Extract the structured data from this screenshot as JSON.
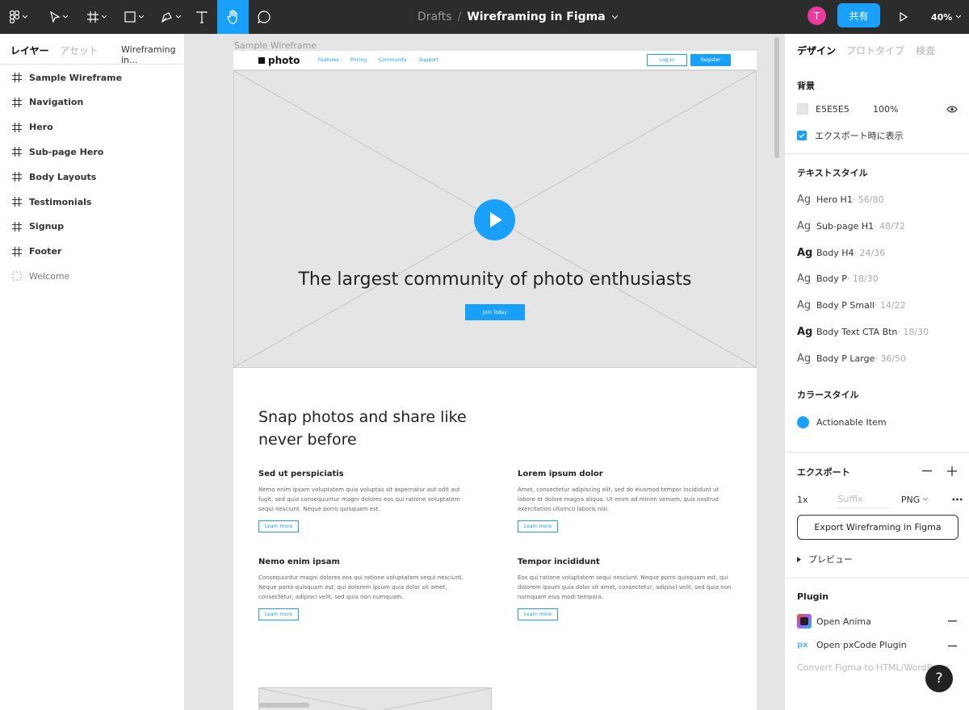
{
  "toolbar": {
    "breadcrumb_drafts": "Drafts",
    "breadcrumb_separator": "/",
    "file_name": "Wireframing in Figma",
    "avatar_initial": "T",
    "share_label": "共有",
    "zoom_label": "40%"
  },
  "layers_panel": {
    "tab_layers": "レイヤー",
    "tab_assets": "アセット",
    "tab_page": "Wireframing in...",
    "items": [
      {
        "label": "Sample Wireframe"
      },
      {
        "label": "Navigation"
      },
      {
        "label": "Hero"
      },
      {
        "label": "Sub-page Hero"
      },
      {
        "label": "Body Layouts"
      },
      {
        "label": "Testimonials"
      },
      {
        "label": "Signup"
      },
      {
        "label": "Footer"
      },
      {
        "label": "Welcome"
      }
    ]
  },
  "canvas": {
    "frame_label": "Sample Wireframe",
    "nav": {
      "logo": "photo",
      "links": [
        "Features",
        "Pricing",
        "Community",
        "Support"
      ],
      "login": "Log in",
      "register": "Register"
    },
    "hero": {
      "headline": "The largest community of photo enthusiasts",
      "cta": "Join Today"
    },
    "section_title": "Snap photos and share like never before",
    "features": [
      {
        "title": "Sed ut perspiciatis",
        "text": "Nemo enim ipsam voluptatem quia voluptas sit aspernatur aut odit aut fugit, sed quia consequuntur magni dolores eos qui ratione voluptatem sequi nesciunt. Neque porro quisquam est.",
        "button": "Learn more"
      },
      {
        "title": "Lorem ipsum dolor",
        "text": "Amet, consectetur adipiscing elit, sed do eiusmod tempor incididunt ut labore et dolore magna aliqua. Ut enim ad minim veniam, quis nostrud exercitation ullamco laboris nisi.",
        "button": "Learn more"
      },
      {
        "title": "Nemo enim ipsam",
        "text": "Consequuntur magni dolores eos qui ratione voluptatem sequi nesciunt. Neque porro quisquam est, qui dolorem ipsum quia dolor sit amet, consectetur, adipisci velit, sed quia non numquam.",
        "button": "Learn more"
      },
      {
        "title": "Tempor incididunt",
        "text": "Eos qui ratione voluptatem sequi nesciunt. Neque porro quisquam est, qui dolorem ipsum quia dolor sit amet, consectetur, adipisci velit, sed quia non numquam eius modi tempora.",
        "button": "Learn more"
      }
    ]
  },
  "design_panel": {
    "tab_design": "デザイン",
    "tab_prototype": "プロトタイプ",
    "tab_inspect": "検査",
    "background_heading": "背景",
    "background_hex": "E5E5E5",
    "background_opacity": "100%",
    "show_in_export": "エクスポート時に表示",
    "text_styles_heading": "テキストスタイル",
    "text_styles": [
      {
        "name": "Hero H1",
        "size": " · 56/80",
        "bold": false
      },
      {
        "name": "Sub-page H1",
        "size": " · 48/72",
        "bold": false
      },
      {
        "name": "Body H4",
        "size": " · 24/36",
        "bold": true
      },
      {
        "name": "Body P",
        "size": " · 18/30",
        "bold": false
      },
      {
        "name": "Body P Small",
        "size": " · 14/22",
        "bold": false
      },
      {
        "name": "Body Text CTA Btn",
        "size": " · 18/30",
        "bold": true
      },
      {
        "name": "Body P Large",
        "size": " · 36/50",
        "bold": false
      }
    ],
    "ag_glyph": "Ag",
    "color_styles_heading": "カラースタイル",
    "color_style_name": "Actionable Item",
    "color_style_color": "#18A0FB",
    "export_heading": "エクスポート",
    "export_scale": "1x",
    "export_suffix_placeholder": "Suffix",
    "export_format": "PNG",
    "export_button": "Export Wireframing in Figma",
    "preview_label": "プレビュー",
    "plugin_heading": "Plugin",
    "plugins": [
      "Open Anima",
      "Open pxCode Plugin"
    ],
    "plugin_more": "Convert Figma to HTML/WordPress",
    "help": "?"
  }
}
